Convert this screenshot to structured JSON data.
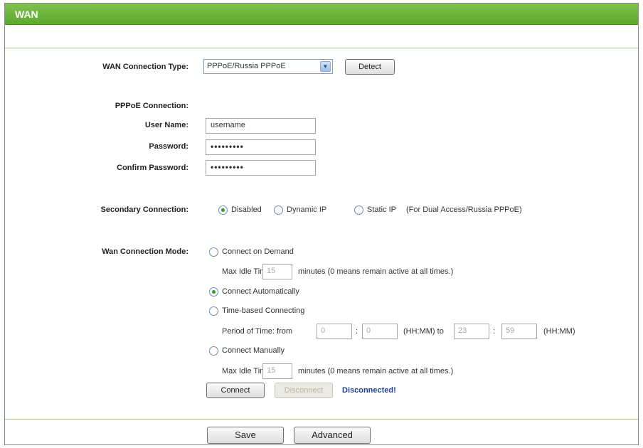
{
  "header": {
    "title": "WAN"
  },
  "connection_type": {
    "label": "WAN Connection Type:",
    "selected": "PPPoE/Russia PPPoE",
    "detect_label": "Detect"
  },
  "pppoe": {
    "section_label": "PPPoE Connection:",
    "username_label": "User Name:",
    "username_value": "username",
    "password_label": "Password:",
    "password_value": "•••••••••",
    "confirm_label": "Confirm Password:",
    "confirm_value": "•••••••••"
  },
  "secondary": {
    "label": "Secondary Connection:",
    "options": [
      "Disabled",
      "Dynamic IP",
      "Static IP"
    ],
    "selected": "Disabled",
    "note": "(For Dual Access/Russia PPPoE)"
  },
  "mode": {
    "label": "Wan Connection Mode:",
    "on_demand_label": "Connect on Demand",
    "max_idle_label": "Max Idle Time:",
    "max_idle_value": "15",
    "minutes_note": "minutes (0 means remain active at all times.)",
    "auto_label": "Connect Automatically",
    "time_based_label": "Time-based Connecting",
    "period_label": "Period of Time: from",
    "from_hh": "0",
    "from_mm": "0",
    "hhmm_to": "(HH:MM) to",
    "to_hh": "23",
    "to_mm": "59",
    "hhmm": "(HH:MM)",
    "manual_label": "Connect Manually",
    "max_idle_label2": "Max Idle Time:",
    "max_idle_value2": "15",
    "minutes_note2": "minutes (0 means remain active at all times.)",
    "selected": "Connect Automatically"
  },
  "actions": {
    "connect_label": "Connect",
    "disconnect_label": "Disconnect",
    "status_text": "Disconnected!",
    "save_label": "Save",
    "advanced_label": "Advanced"
  },
  "colors": {
    "header_green": "#6ab43c",
    "status_blue": "#1d3fa0",
    "radio_checked": "#2f9a2f"
  }
}
